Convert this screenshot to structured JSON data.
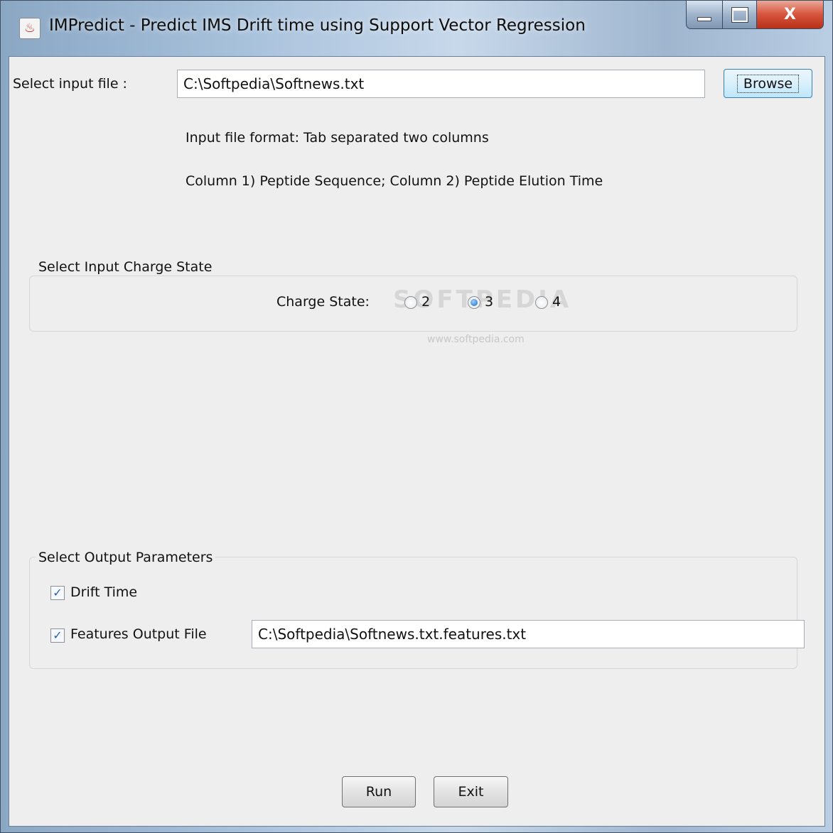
{
  "window": {
    "title": "IMPredict -  Predict IMS Drift time using Support Vector Regression",
    "close_glyph": "X"
  },
  "input": {
    "label": "Select input file :",
    "value": "C:\\Softpedia\\Softnews.txt",
    "browse_label": "Browse",
    "format_line1": "Input file format: Tab separated two columns",
    "format_line2": "Column 1)  Peptide Sequence; Column 2) Peptide Elution Time"
  },
  "charge": {
    "group_title": "Select Input Charge State",
    "label": "Charge State:",
    "options": [
      {
        "label": "2",
        "checked": false
      },
      {
        "label": "3",
        "checked": true
      },
      {
        "label": "4",
        "checked": false
      }
    ]
  },
  "output": {
    "group_title": "Select Output Parameters",
    "drift_time_label": "Drift Time",
    "drift_time_checked": true,
    "features_label": "Features Output File",
    "features_checked": true,
    "features_value": "C:\\Softpedia\\Softnews.txt.features.txt"
  },
  "buttons": {
    "run": "Run",
    "exit": "Exit"
  },
  "watermark": {
    "main": "SOFTPEDIA",
    "url": "www.softpedia.com"
  },
  "icons": {
    "app": "java-cup-icon",
    "minimize": "minimize-icon",
    "maximize": "maximize-icon",
    "close": "close-icon"
  }
}
